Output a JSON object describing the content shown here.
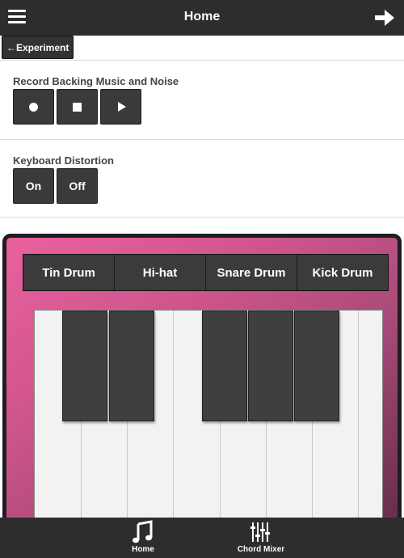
{
  "header": {
    "title": "Home"
  },
  "back_button": {
    "label": "←Experiment"
  },
  "record": {
    "label": "Record Backing Music and Noise",
    "buttons": [
      "record",
      "stop",
      "play"
    ]
  },
  "distortion": {
    "label": "Keyboard Distortion",
    "on_label": "On",
    "off_label": "Off"
  },
  "drums": [
    "Tin Drum",
    "Hi-hat",
    "Snare Drum",
    "Kick Drum"
  ],
  "footer": {
    "home_label": "Home",
    "chord_mixer_label": "Chord Mixer"
  },
  "colors": {
    "bar": "#2d2d2d",
    "panel_pink": "#e8619f",
    "panel_dark": "#5a2a42"
  }
}
